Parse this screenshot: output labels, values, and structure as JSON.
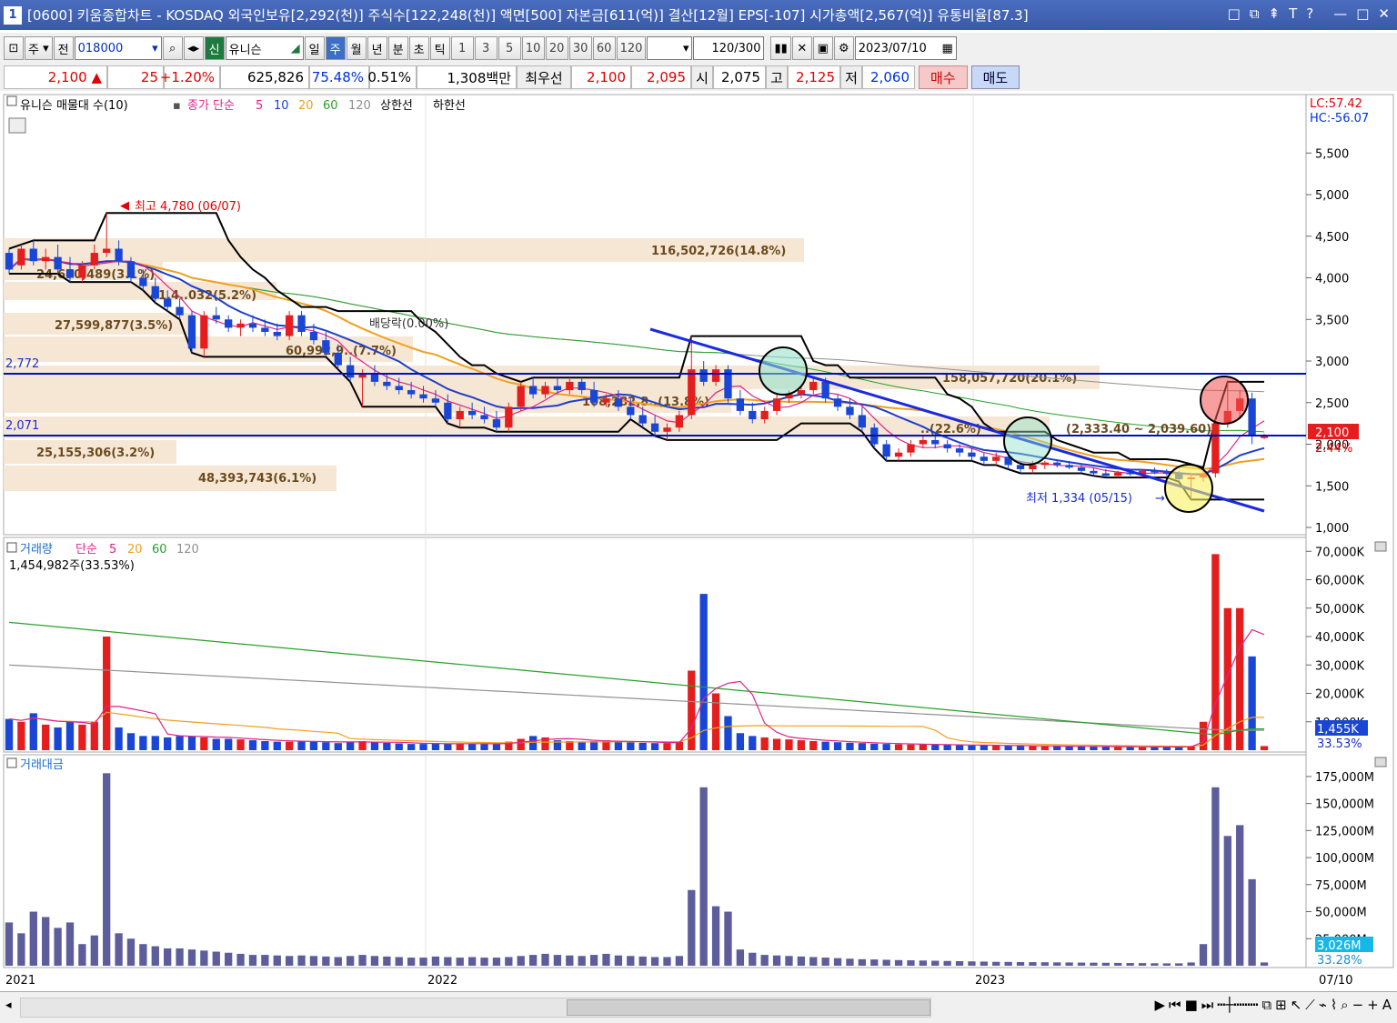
{
  "window": {
    "index": "1",
    "title": "[0600] 키움종합차트 - KOSDAQ 외국인보유[2,292(천)] 주식수[122,248(천)] 액면[500] 자본금[611(억)] 결산[12월] EPS[-107] 시가총액[2,567(억)] 유통비율[87.3]",
    "controls": [
      "□",
      "⧉",
      "⇞",
      "T",
      "?",
      "—",
      "□",
      "✕"
    ]
  },
  "toolbar": {
    "market_select": "주",
    "prev_label": "전",
    "code": "018000",
    "stock_badge": "신",
    "stock_name": "유니슨",
    "periods": [
      "일",
      "주",
      "월",
      "년",
      "분",
      "초",
      "틱"
    ],
    "selected_period": "주",
    "intervals": [
      "1",
      "3",
      "5",
      "10",
      "20",
      "30",
      "60",
      "120"
    ],
    "count": "120",
    "count_max": "/300",
    "date": "2023/07/10"
  },
  "quote": {
    "price": "2,100",
    "arrow": "▲",
    "change": "25",
    "change_pct": "+1.20%",
    "volume": "625,826",
    "vol_ratio": "75.48%",
    "turnover": "0.51%",
    "amount": "1,308백만",
    "best_label": "최우선",
    "ask": "2,100",
    "bid": "2,095",
    "open_label": "시",
    "open": "2,075",
    "high_label": "고",
    "high": "2,125",
    "low_label": "저",
    "low": "2,060",
    "buy_label": "매수",
    "sell_label": "매도"
  },
  "colors": {
    "up": "#e41e1e",
    "down": "#1a46d6",
    "ma5": "#e0228a",
    "ma10": "#1f3fc8",
    "ma20": "#f0a020",
    "ma60": "#2aa02a",
    "ma120": "#909090",
    "band": "#000000",
    "hline": "#0010c0",
    "trend": "#1b2ae0",
    "volume_bar": "#5d5d9c",
    "profile": "#f5e4d0"
  },
  "price_panel": {
    "legend": {
      "indicator": "유니슨 매물대 수(10)",
      "ma_label": "종가 단순",
      "ma": [
        "5",
        "10",
        "20",
        "60",
        "120"
      ],
      "upper": "상한선",
      "lower": "하한선"
    },
    "lc": "LC:57.42",
    "hc": "HC:-56.07",
    "current_price": "2,100",
    "current_pct": "2.44%",
    "hlines": [
      "2,772",
      "2,071"
    ],
    "ylim": [
      1000,
      5700
    ],
    "y_ticks": [
      "5,500",
      "5,000",
      "4,500",
      "4,000",
      "3,500",
      "3,000",
      "2,500",
      "2,000",
      "1,500",
      "1,000"
    ],
    "annotations": {
      "high": "최고 4,780 (06/07)",
      "low": "최저 1,334 (05/15)",
      "dividend": "배당락(0.00%)",
      "dividend2": "배당락(0.00%)",
      "range": "(2,333.40 ~ 2,039.60)"
    },
    "profile": [
      {
        "label": "116,502,726(14.8%)"
      },
      {
        "label": "24,670,489(3.1%)"
      },
      {
        "label": "41,4..032(5.2%)"
      },
      {
        "label": "27,599,877(3.5%)"
      },
      {
        "label": "60,992,9..(7.7%)"
      },
      {
        "label": "158,057,720(20.1%)"
      },
      {
        "label": "108,282,8..(13.8%)"
      },
      {
        "label": "..(22.6%)"
      },
      {
        "label": "25,155,306(3.2%)"
      },
      {
        "label": "48,393,743(6.1%)"
      }
    ]
  },
  "volume_panel": {
    "legend": {
      "title": "거래량",
      "ma_label": "단순",
      "ma": [
        "5",
        "20",
        "60",
        "120"
      ]
    },
    "summary": "1,454,982주(33.53%)",
    "current": "1,455K",
    "current_pct": "33.53%",
    "y_ticks": [
      "70,000K",
      "60,000K",
      "50,000K",
      "40,000K",
      "30,000K",
      "20,000K",
      "10,000K"
    ]
  },
  "amount_panel": {
    "legend": {
      "title": "거래대금"
    },
    "current": "3,026M",
    "current_pct": "33.28%",
    "y_ticks": [
      "175,000M",
      "150,000M",
      "125,000M",
      "100,000M",
      "75,000M",
      "50,000M",
      "25,000M"
    ]
  },
  "x_axis": {
    "labels": [
      "2021",
      "2022",
      "2023"
    ],
    "last": "07/10"
  },
  "chart_data": {
    "type": "candlestick",
    "x_labels": [
      "2021",
      "2022",
      "2023"
    ],
    "candles_ohlc": [
      [
        4300,
        4350,
        4050,
        4100
      ],
      [
        4150,
        4400,
        4100,
        4350
      ],
      [
        4350,
        4450,
        4150,
        4200
      ],
      [
        4200,
        4350,
        4100,
        4250
      ],
      [
        4250,
        4400,
        4050,
        4100
      ],
      [
        4100,
        4250,
        3950,
        4000
      ],
      [
        4000,
        4200,
        3950,
        4150
      ],
      [
        4150,
        4400,
        4100,
        4300
      ],
      [
        4300,
        4780,
        4250,
        4350
      ],
      [
        4350,
        4450,
        4150,
        4200
      ],
      [
        4200,
        4250,
        3950,
        4000
      ],
      [
        4000,
        4100,
        3850,
        3900
      ],
      [
        3900,
        4000,
        3700,
        3750
      ],
      [
        3750,
        3850,
        3600,
        3650
      ],
      [
        3650,
        3750,
        3500,
        3550
      ],
      [
        3550,
        3600,
        3100,
        3150
      ],
      [
        3150,
        3600,
        3050,
        3550
      ],
      [
        3550,
        3650,
        3450,
        3500
      ],
      [
        3500,
        3550,
        3350,
        3400
      ],
      [
        3400,
        3500,
        3300,
        3450
      ],
      [
        3450,
        3550,
        3350,
        3400
      ],
      [
        3400,
        3500,
        3300,
        3350
      ],
      [
        3350,
        3450,
        3250,
        3300
      ],
      [
        3300,
        3600,
        3250,
        3550
      ],
      [
        3550,
        3600,
        3300,
        3350
      ],
      [
        3350,
        3450,
        3200,
        3250
      ],
      [
        3250,
        3350,
        3050,
        3100
      ],
      [
        3100,
        3200,
        2900,
        2950
      ],
      [
        2950,
        3050,
        2750,
        2800
      ],
      [
        2800,
        2900,
        2450,
        2850
      ],
      [
        2850,
        2950,
        2700,
        2750
      ],
      [
        2750,
        2850,
        2650,
        2700
      ],
      [
        2700,
        2800,
        2600,
        2650
      ],
      [
        2650,
        2750,
        2550,
        2600
      ],
      [
        2600,
        2700,
        2500,
        2550
      ],
      [
        2550,
        2650,
        2450,
        2500
      ],
      [
        2500,
        2600,
        2250,
        2300
      ],
      [
        2300,
        2450,
        2200,
        2400
      ],
      [
        2400,
        2500,
        2300,
        2350
      ],
      [
        2350,
        2450,
        2250,
        2300
      ],
      [
        2300,
        2400,
        2150,
        2200
      ],
      [
        2200,
        2500,
        2150,
        2450
      ],
      [
        2450,
        2750,
        2400,
        2700
      ],
      [
        2700,
        2800,
        2550,
        2600
      ],
      [
        2600,
        2750,
        2550,
        2700
      ],
      [
        2700,
        2800,
        2600,
        2650
      ],
      [
        2650,
        2800,
        2600,
        2750
      ],
      [
        2750,
        2800,
        2600,
        2650
      ],
      [
        2650,
        2750,
        2450,
        2500
      ],
      [
        2500,
        2600,
        2450,
        2550
      ],
      [
        2550,
        2650,
        2400,
        2450
      ],
      [
        2450,
        2550,
        2300,
        2350
      ],
      [
        2350,
        2450,
        2200,
        2250
      ],
      [
        2250,
        2350,
        2100,
        2150
      ],
      [
        2150,
        2250,
        2050,
        2200
      ],
      [
        2200,
        2400,
        2150,
        2350
      ],
      [
        2350,
        3300,
        2300,
        2900
      ],
      [
        2900,
        3000,
        2700,
        2750
      ],
      [
        2750,
        2950,
        2700,
        2900
      ],
      [
        2900,
        2950,
        2500,
        2550
      ],
      [
        2550,
        2650,
        2350,
        2400
      ],
      [
        2400,
        2500,
        2250,
        2300
      ],
      [
        2300,
        2450,
        2250,
        2400
      ],
      [
        2400,
        2600,
        2350,
        2550
      ],
      [
        2550,
        2650,
        2500,
        2600
      ],
      [
        2600,
        2700,
        2550,
        2650
      ],
      [
        2650,
        2800,
        2600,
        2750
      ],
      [
        2750,
        2800,
        2500,
        2550
      ],
      [
        2550,
        2600,
        2400,
        2450
      ],
      [
        2450,
        2550,
        2300,
        2350
      ],
      [
        2350,
        2450,
        2150,
        2200
      ],
      [
        2200,
        2250,
        1950,
        2000
      ],
      [
        2000,
        2050,
        1800,
        1850
      ],
      [
        1850,
        1950,
        1800,
        1900
      ],
      [
        1900,
        2050,
        1850,
        2000
      ],
      [
        2000,
        2100,
        1950,
        2050
      ],
      [
        2050,
        2150,
        1950,
        2000
      ],
      [
        2000,
        2050,
        1900,
        1950
      ],
      [
        1950,
        2000,
        1850,
        1900
      ],
      [
        1900,
        1950,
        1800,
        1850
      ],
      [
        1850,
        1900,
        1750,
        1800
      ],
      [
        1800,
        1900,
        1750,
        1850
      ],
      [
        1850,
        1900,
        1700,
        1750
      ],
      [
        1750,
        1800,
        1650,
        1700
      ],
      [
        1700,
        1800,
        1650,
        1750
      ],
      [
        1750,
        1800,
        1700,
        1780
      ],
      [
        1780,
        1820,
        1720,
        1750
      ],
      [
        1750,
        1800,
        1700,
        1720
      ],
      [
        1720,
        1760,
        1650,
        1680
      ],
      [
        1680,
        1720,
        1620,
        1650
      ],
      [
        1650,
        1700,
        1600,
        1620
      ],
      [
        1620,
        1680,
        1600,
        1660
      ],
      [
        1660,
        1700,
        1620,
        1640
      ],
      [
        1640,
        1700,
        1600,
        1680
      ],
      [
        1680,
        1720,
        1640,
        1660
      ],
      [
        1660,
        1700,
        1620,
        1650
      ],
      [
        1650,
        1680,
        1550,
        1580
      ],
      [
        1580,
        1620,
        1334,
        1600
      ],
      [
        1600,
        1700,
        1550,
        1650
      ],
      [
        1650,
        2300,
        1600,
        2250
      ],
      [
        2250,
        2750,
        2200,
        2400
      ],
      [
        2400,
        2650,
        2300,
        2550
      ],
      [
        2550,
        2620,
        2000,
        2100
      ],
      [
        2075,
        2125,
        2060,
        2100
      ]
    ],
    "volume_thousands": [
      11000,
      10000,
      13000,
      9000,
      8000,
      10000,
      9000,
      10000,
      40000,
      8000,
      6000,
      5000,
      5000,
      4500,
      5000,
      5000,
      4500,
      4000,
      4000,
      3800,
      3500,
      3200,
      3000,
      3000,
      3200,
      3000,
      2800,
      2500,
      3000,
      3200,
      2800,
      2600,
      2400,
      2200,
      2200,
      2500,
      2300,
      2200,
      2300,
      2200,
      2200,
      3000,
      4000,
      5000,
      4500,
      3500,
      3200,
      3000,
      3200,
      3500,
      3000,
      2800,
      2600,
      2500,
      2500,
      3000,
      28000,
      55000,
      20000,
      12000,
      6000,
      5000,
      4500,
      4000,
      3800,
      3500,
      3200,
      3000,
      2800,
      2600,
      2500,
      2300,
      2200,
      2100,
      2000,
      2000,
      1900,
      1800,
      1800,
      1700,
      1700,
      1600,
      1600,
      1500,
      1500,
      1400,
      1400,
      1300,
      1300,
      1300,
      1200,
      1200,
      1200,
      1100,
      1100,
      1100,
      1100,
      1500,
      10000,
      69000,
      50000,
      50000,
      33000,
      1455
    ],
    "amount_millions": [
      40000,
      30000,
      50000,
      45000,
      35000,
      40000,
      20000,
      28000,
      178000,
      30000,
      25000,
      20000,
      18000,
      16000,
      16000,
      15000,
      14000,
      13000,
      12000,
      11000,
      10000,
      10000,
      9500,
      9000,
      9500,
      9000,
      8500,
      8000,
      9000,
      10000,
      9000,
      8500,
      8000,
      7500,
      7500,
      8500,
      8000,
      7500,
      8000,
      7500,
      7500,
      8000,
      9000,
      10000,
      11000,
      10000,
      9500,
      9000,
      10000,
      11000,
      9500,
      9000,
      8500,
      8000,
      8000,
      9000,
      70000,
      165000,
      55000,
      50000,
      15000,
      12000,
      10000,
      9500,
      9000,
      8500,
      8000,
      7500,
      7000,
      6500,
      6000,
      5800,
      5500,
      5200,
      5000,
      4800,
      4600,
      4400,
      4200,
      4000,
      3800,
      3600,
      3500,
      3400,
      3300,
      3200,
      3100,
      3000,
      2900,
      2800,
      2700,
      2600,
      2500,
      2400,
      2300,
      2200,
      2200,
      3000,
      20000,
      165000,
      120000,
      130000,
      80000,
      3026
    ],
    "price_ylim": [
      1000,
      5700
    ],
    "volume_ylim": [
      0,
      72000
    ],
    "amount_ylim": [
      0,
      185000
    ]
  }
}
